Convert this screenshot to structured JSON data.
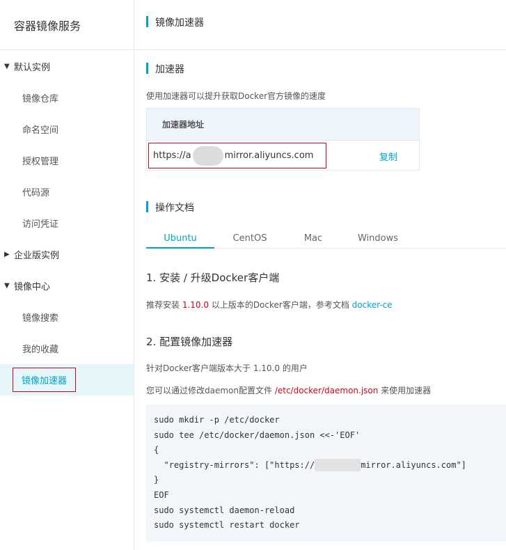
{
  "sidebar": {
    "title": "容器镜像服务",
    "groups": [
      {
        "label": "默认实例",
        "expanded": true,
        "items": [
          "镜像仓库",
          "命名空间",
          "授权管理",
          "代码源",
          "访问凭证"
        ]
      },
      {
        "label": "企业版实例",
        "expanded": false,
        "items": []
      },
      {
        "label": "镜像中心",
        "expanded": true,
        "items": [
          "镜像搜索",
          "我的收藏",
          "镜像加速器"
        ]
      }
    ],
    "active_item": "镜像加速器"
  },
  "main": {
    "page_title": "镜像加速器",
    "accelerator": {
      "section_title": "加速器",
      "description": "使用加速器可以提升获取Docker官方镜像的速度",
      "table_header": "加速器地址",
      "url_prefix": "https://a",
      "url_suffix": "mirror.aliyuncs.com",
      "copy_label": "复制"
    },
    "docs": {
      "section_title": "操作文档",
      "tabs": [
        "Ubuntu",
        "CentOS",
        "Mac",
        "Windows"
      ],
      "active_tab": "Ubuntu",
      "step1_title": "1. 安装 / 升级Docker客户端",
      "step1_text_a": "推荐安装 ",
      "step1_version": "1.10.0",
      "step1_text_b": " 以上版本的Docker客户端，参考文档 ",
      "step1_link": "docker-ce",
      "step2_title": "2. 配置镜像加速器",
      "step2_text1": "针对Docker客户端版本大于 1.10.0 的用户",
      "step2_text2_a": "您可以通过修改daemon配置文件 ",
      "step2_path": "/etc/docker/daemon.json",
      "step2_text2_b": " 来使用加速器",
      "code_lines": [
        "sudo mkdir -p /etc/docker",
        "sudo tee /etc/docker/daemon.json <<-'EOF'",
        "{",
        "  \"registry-mirrors\": [\"https://",
        "}",
        "EOF",
        "sudo systemctl daemon-reload",
        "sudo systemctl restart docker"
      ],
      "code_line4_suffix": "mirror.aliyuncs.com\"]"
    }
  },
  "colors": {
    "accent": "#00a2ca",
    "highlight_border": "#d0021b",
    "active_bg": "#e6f7fa",
    "code_bg": "#f2f6fa"
  }
}
